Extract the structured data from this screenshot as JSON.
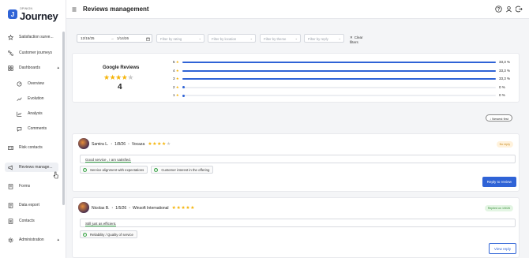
{
  "brand": {
    "small": "OPINION",
    "name": "Journey",
    "letter": "J"
  },
  "sidebar": {
    "items": [
      {
        "label": "Satisfaction surve..."
      },
      {
        "label": "Customer journeys"
      },
      {
        "label": "Dashboards"
      },
      {
        "label": "Overview"
      },
      {
        "label": "Evolution"
      },
      {
        "label": "Analysis"
      },
      {
        "label": "Comments"
      },
      {
        "label": "Risk contacts"
      },
      {
        "label": "Reviews manage..."
      },
      {
        "label": "Forms"
      },
      {
        "label": "Data export"
      },
      {
        "label": "Contacts"
      },
      {
        "label": "Administration"
      }
    ]
  },
  "header": {
    "title": "Reviews management"
  },
  "filters": {
    "date_from": "12/15/25",
    "date_to": "1/14/26",
    "rating_placeholder": "Filter by rating",
    "location_placeholder": "Filter by location",
    "theme_placeholder": "Filter by theme",
    "reply_placeholder": "Filter by reply",
    "clear_label": "Clear filters"
  },
  "summary": {
    "title": "Google Reviews",
    "score": "4",
    "stars_filled": 4,
    "distribution": [
      {
        "star": "5",
        "percent_label": "33,3 %",
        "value": 33.3
      },
      {
        "star": "4",
        "percent_label": "33,3 %",
        "value": 33.3
      },
      {
        "star": "3",
        "percent_label": "33,3 %",
        "value": 33.3
      },
      {
        "star": "2",
        "percent_label": "0 %",
        "value": 0
      },
      {
        "star": "1",
        "percent_label": "0 %",
        "value": 0
      }
    ]
  },
  "sort": {
    "label": "Newest first"
  },
  "reviews": [
    {
      "author": "Samira L.",
      "date": "1/8/26",
      "location": "Vocaza",
      "rating": 4,
      "status": "No reply",
      "comment": "Good service , I am satisfied.",
      "tags": [
        "Service alignment with expectations",
        "Customer interest in the offering"
      ],
      "action": "Reply to review"
    },
    {
      "author": "Nicolas B.",
      "date": "1/5/26",
      "location": "Winsoft International",
      "rating": 5,
      "status": "Replied on 1/5/26",
      "comment": "Still just as efficient.",
      "tags": [
        "Reliability / Quality of service"
      ],
      "action": "View reply"
    }
  ],
  "colors": {
    "accent": "#2f63d6",
    "star": "#f5b40a",
    "positive": "#3da64a"
  }
}
